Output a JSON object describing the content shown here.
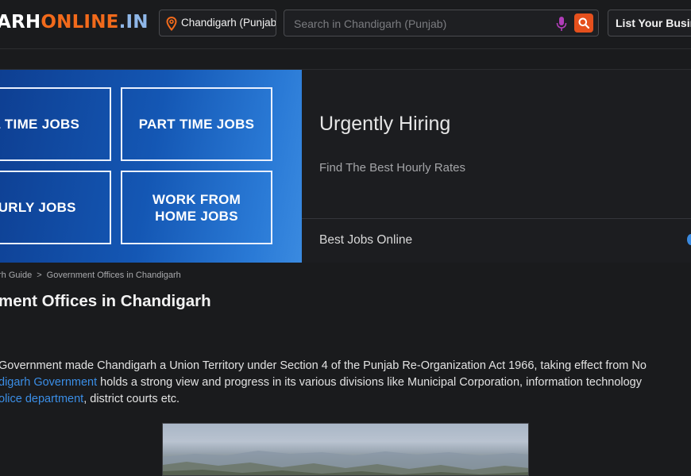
{
  "header": {
    "logo_part1": "ARH",
    "logo_part2": "ONLINE",
    "logo_part3": ".IN",
    "location": "Chandigarh (Punjab)",
    "search_placeholder": "Search in Chandigarh (Punjab)",
    "list_button": "List Your Business"
  },
  "ad": {
    "jobs": [
      "LL TIME JOBS",
      "PART TIME JOBS",
      "OURLY JOBS",
      "WORK FROM HOME JOBS"
    ],
    "title": "Urgently Hiring",
    "subtitle": "Find The Best Hourly Rates",
    "footer": "Best Jobs Online"
  },
  "breadcrumb": {
    "item1": "rh Guide",
    "separator": ">",
    "item2": "Government Offices in Chandigarh"
  },
  "page": {
    "title": "ment Offices in Chandigarh",
    "line1": "Government made Chandigarh a Union Territory under Section 4 of the Punjab Re-Organization Act 1966, taking effect from No",
    "line2_link": "digarh Government",
    "line2_text": " holds a strong view and progress in its various divisions like Municipal Corporation, information technology",
    "line3_link": "olice department",
    "line3_text": ", district courts etc."
  },
  "colors": {
    "accent_orange": "#e5501d",
    "link_blue": "#3b8ee6",
    "banner_blue": "#1457b4"
  },
  "icons": {
    "location": "location-pin-icon",
    "mic": "microphone-icon",
    "search": "search-icon"
  }
}
